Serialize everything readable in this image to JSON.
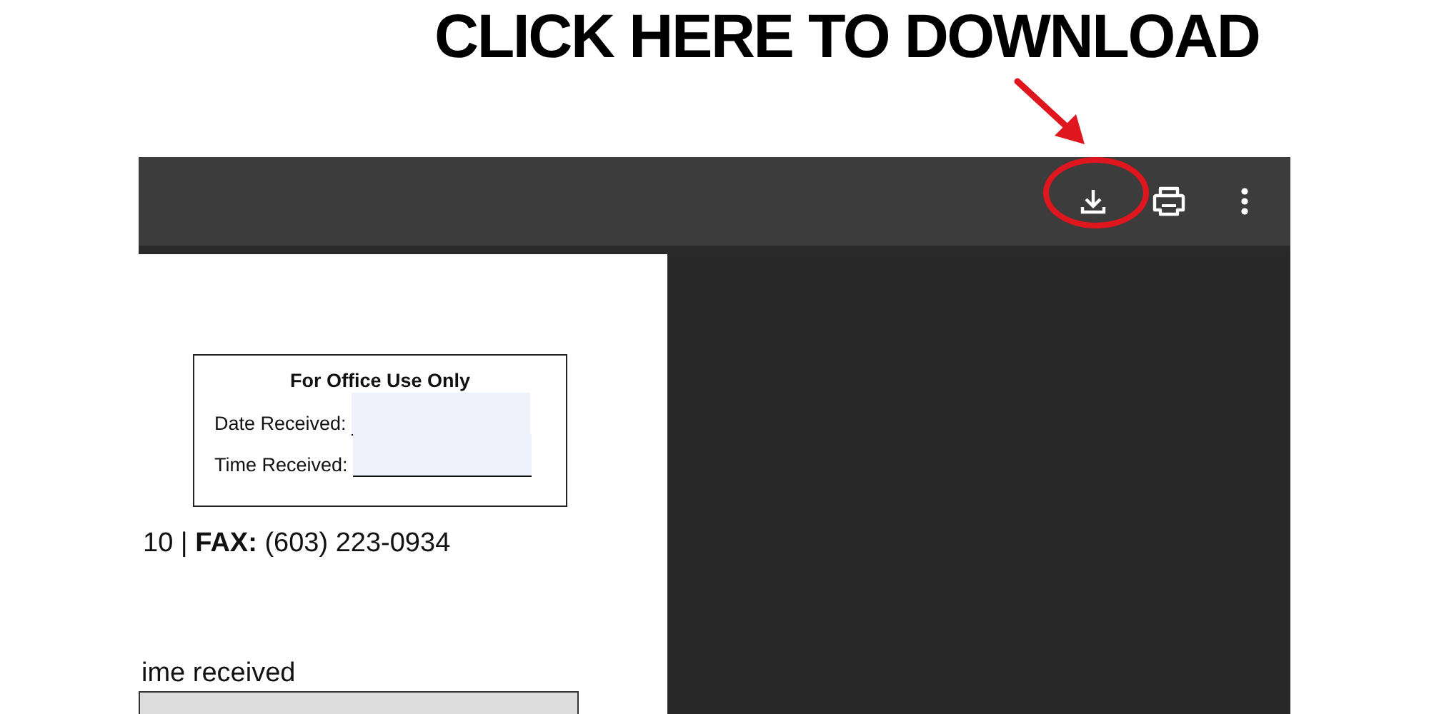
{
  "headline": "CLICK HERE TO DOWNLOAD",
  "toolbar": {
    "buttons": [
      {
        "kind": "download",
        "highlighted": true
      },
      {
        "kind": "print",
        "highlighted": false
      },
      {
        "kind": "more",
        "highlighted": false
      }
    ]
  },
  "document": {
    "office_box": {
      "title": "For Office Use Only",
      "fields": [
        {
          "label": "Date Received:"
        },
        {
          "label": "Time Received:"
        }
      ]
    },
    "contact_line": "10 | **FAX:** (603) 223-0934",
    "section_label": "ime received"
  }
}
